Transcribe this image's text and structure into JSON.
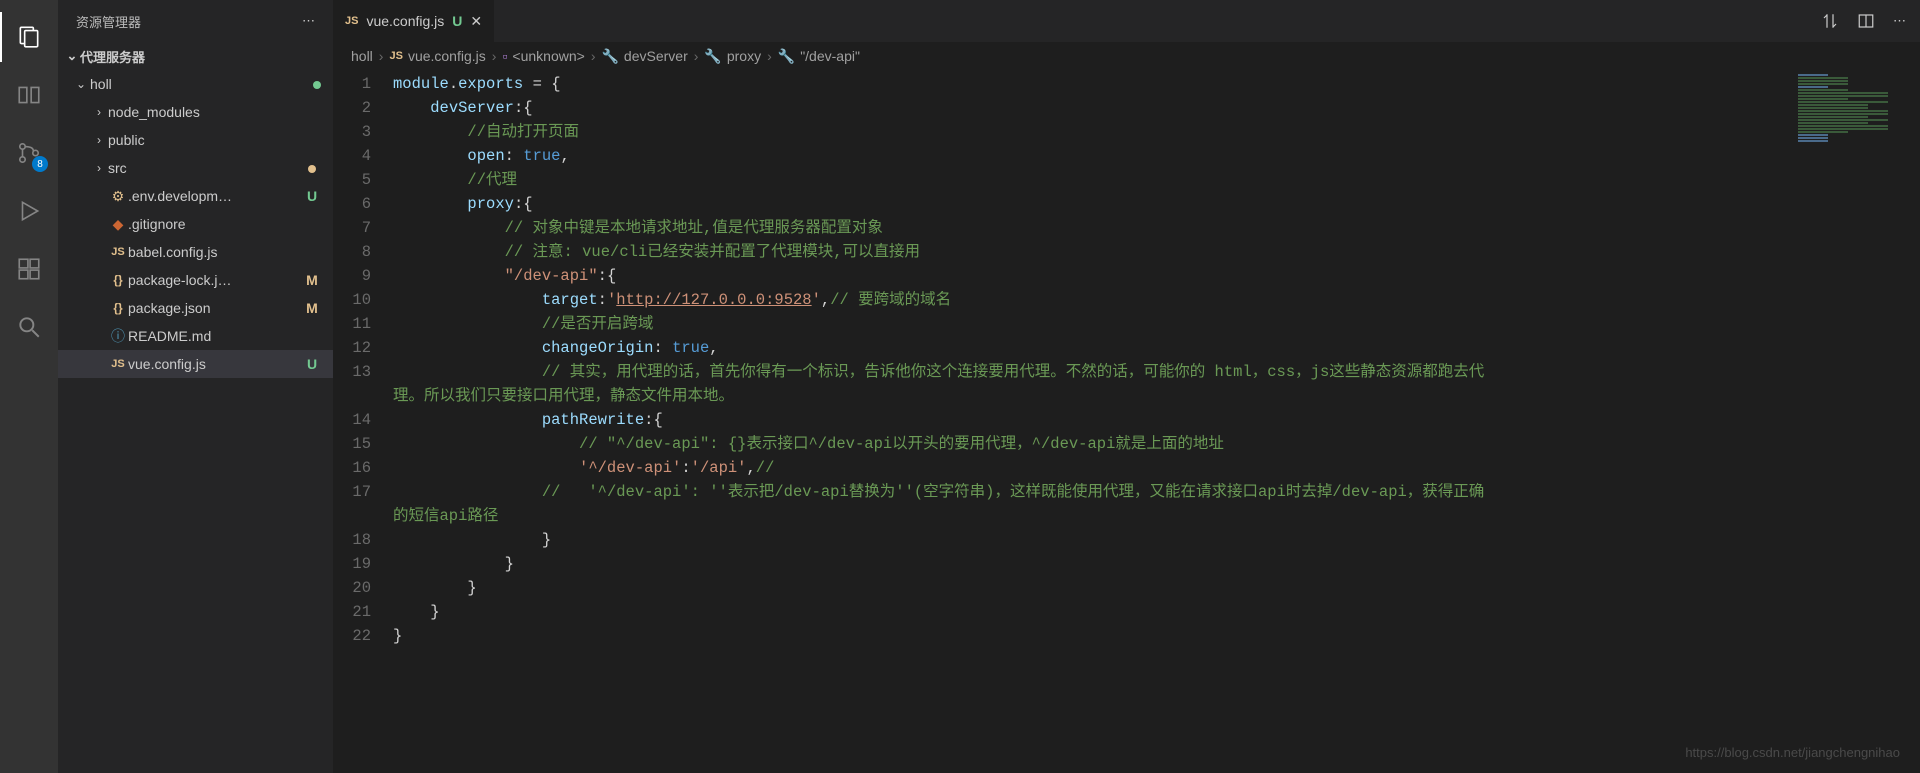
{
  "activity": {
    "badge_scm": "8"
  },
  "sidebar": {
    "title": "资源管理器",
    "section": "代理服务器",
    "root": "holl",
    "items": [
      {
        "name": "node_modules",
        "folder": true,
        "indent": 2,
        "status": ""
      },
      {
        "name": "public",
        "folder": true,
        "indent": 2,
        "status": ""
      },
      {
        "name": "src",
        "folder": true,
        "indent": 2,
        "status": "dot-orange"
      },
      {
        "name": ".env.developm…",
        "folder": false,
        "icon": "env",
        "indent": 2,
        "status": "U"
      },
      {
        "name": ".gitignore",
        "folder": false,
        "icon": "git",
        "indent": 2,
        "status": ""
      },
      {
        "name": "babel.config.js",
        "folder": false,
        "icon": "js",
        "indent": 2,
        "status": ""
      },
      {
        "name": "package-lock.j…",
        "folder": false,
        "icon": "json",
        "indent": 2,
        "status": "M"
      },
      {
        "name": "package.json",
        "folder": false,
        "icon": "json",
        "indent": 2,
        "status": "M"
      },
      {
        "name": "README.md",
        "folder": false,
        "icon": "readme",
        "indent": 2,
        "status": ""
      },
      {
        "name": "vue.config.js",
        "folder": false,
        "icon": "js",
        "indent": 2,
        "status": "U",
        "active": true
      }
    ]
  },
  "tab": {
    "icon": "JS",
    "label": "vue.config.js",
    "status": "U"
  },
  "breadcrumbs": [
    {
      "label": "holl",
      "icon": ""
    },
    {
      "label": "vue.config.js",
      "icon": "js"
    },
    {
      "label": "<unknown>",
      "icon": "cube"
    },
    {
      "label": "devServer",
      "icon": "wrench"
    },
    {
      "label": "proxy",
      "icon": "wrench"
    },
    {
      "label": "\"/dev-api\"",
      "icon": "wrench"
    }
  ],
  "code": {
    "linecount": 22,
    "l1": "module.exports = {",
    "l2_key": "devServer",
    "l3": "//自动打开页面",
    "l4_key": "open",
    "l4_val": "true",
    "l5": "//代理",
    "l6_key": "proxy",
    "l7": "// 对象中键是本地请求地址,值是代理服务器配置对象",
    "l8": "// 注意: vue/cli已经安装并配置了代理模块,可以直接用",
    "l9_key": "\"/dev-api\"",
    "l10_key": "target",
    "l10_url": "http://127.0.0.0:9528",
    "l10_c": "// 要跨域的域名",
    "l11": "//是否开启跨域",
    "l12_key": "changeOrigin",
    "l12_val": "true",
    "l13": "// 其实，用代理的话，首先你得有一个标识，告诉他你这个连接要用代理。不然的话，可能你的 html，css，js这些静态资源都跑去代理。所以我们只要接口用代理，静态文件用本地。",
    "l14_key": "pathRewrite",
    "l15": "// \"^/dev-api\": {}表示接口^/dev-api以开头的要用代理，^/dev-api就是上面的地址",
    "l16_k": "'^/dev-api'",
    "l16_v": "'/api'",
    "l16_c": "//",
    "l17": "//   '^/dev-api': ''表示把/dev-api替换为''(空字符串)，这样既能使用代理，又能在请求接口api时去掉/dev-api，获得正确的短信api路径"
  },
  "watermark": "https://blog.csdn.net/jiangchengnihao"
}
